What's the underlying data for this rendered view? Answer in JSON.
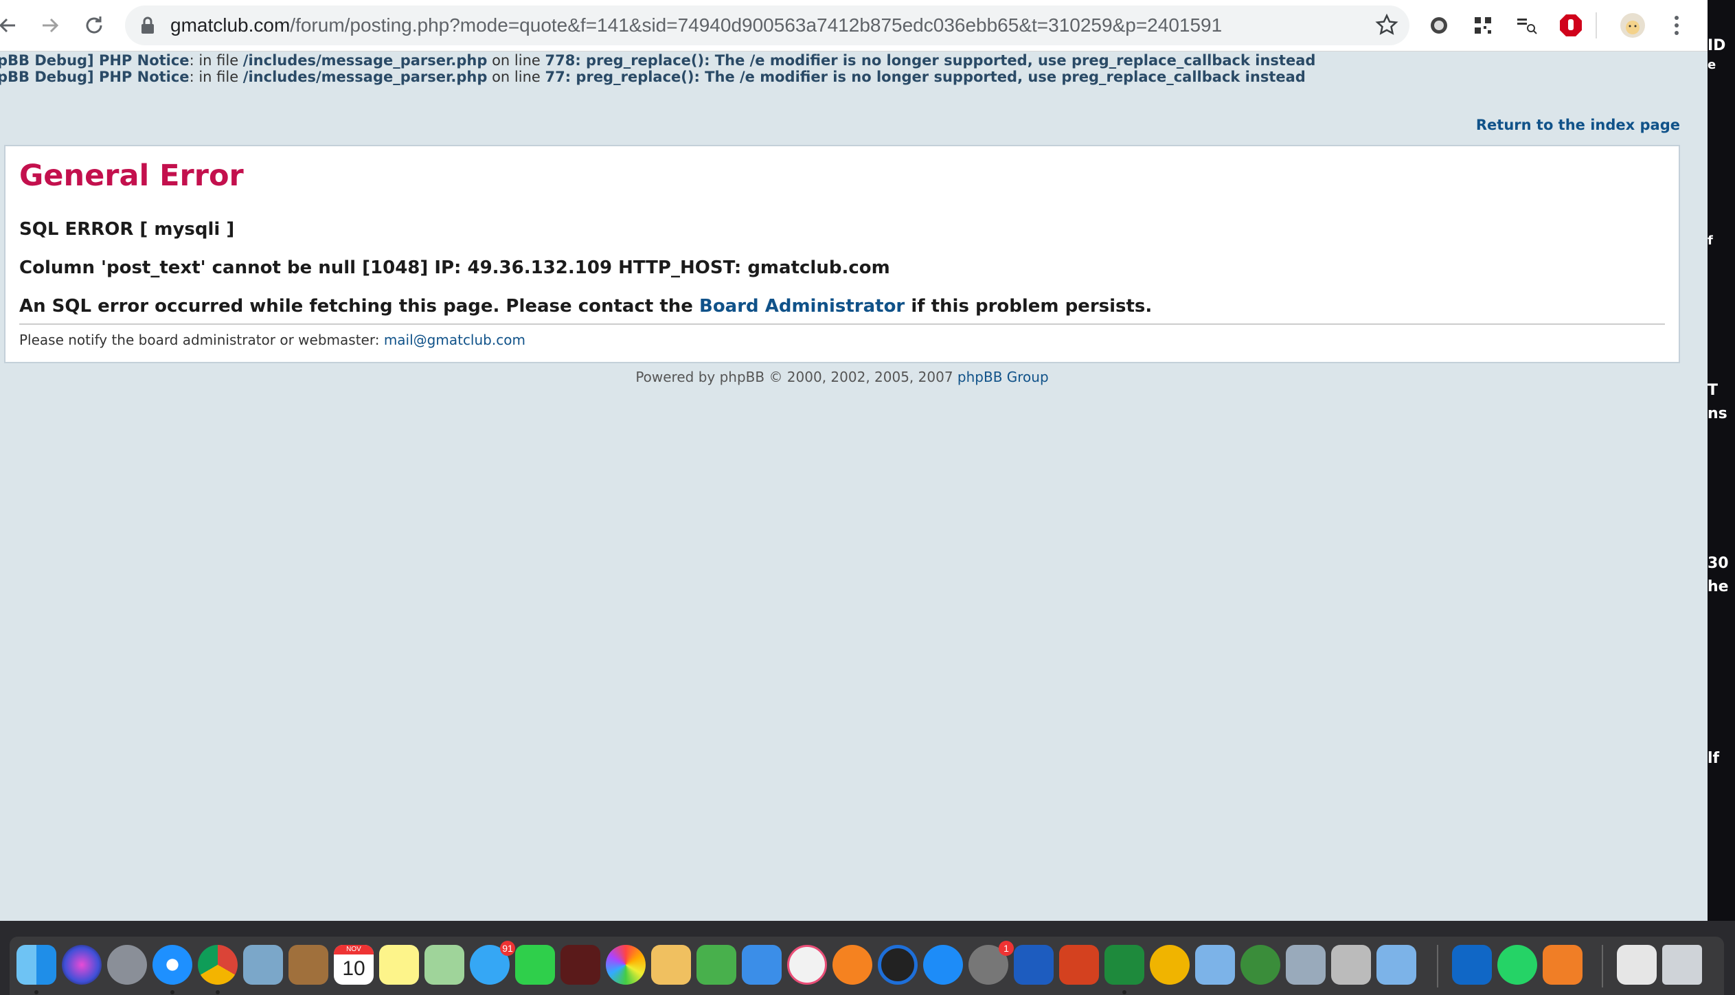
{
  "browser": {
    "url_host": "gmatclub.com",
    "url_path": "/forum/posting.php?mode=quote&f=141&sid=74940d900563a7412b875edc036ebb65&t=310259&p=2401591"
  },
  "debug_lines": [
    {
      "prefix": "pBB Debug] PHP Notice",
      "in_file": ": in file ",
      "file": "/includes/message_parser.php",
      "on_line": " on line ",
      "line": "778",
      "message": ": preg_replace(): The /e modifier is no longer supported, use preg_replace_callback instead"
    },
    {
      "prefix": "pBB Debug] PHP Notice",
      "in_file": ": in file ",
      "file": "/includes/message_parser.php",
      "on_line": " on line ",
      "line": "77",
      "message": ": preg_replace(): The /e modifier is no longer supported, use preg_replace_callback instead"
    }
  ],
  "page": {
    "return_link": "Return to the index page",
    "title": "General Error",
    "sql_error": "SQL ERROR [ mysqli ]",
    "column_error": "Column 'post_text' cannot be null [1048] IP: 49.36.132.109 HTTP_HOST: gmatclub.com",
    "message_before": "An SQL error occurred while fetching this page. Please contact the ",
    "message_link": "Board Administrator",
    "message_after": " if this problem persists.",
    "notify_text": "Please notify the board administrator or webmaster: ",
    "notify_email": "mail@gmatclub.com",
    "footer_text": "Powered by phpBB © 2000, 2002, 2005, 2007 ",
    "footer_link": "phpBB Group"
  },
  "right_strip": [
    "ID",
    "e",
    "f",
    "T",
    "ns",
    "30",
    "he",
    "lf"
  ],
  "dock": {
    "calendar_month": "NOV",
    "calendar_day": "10",
    "messages_badge": "91",
    "prefs_badge": "1"
  }
}
